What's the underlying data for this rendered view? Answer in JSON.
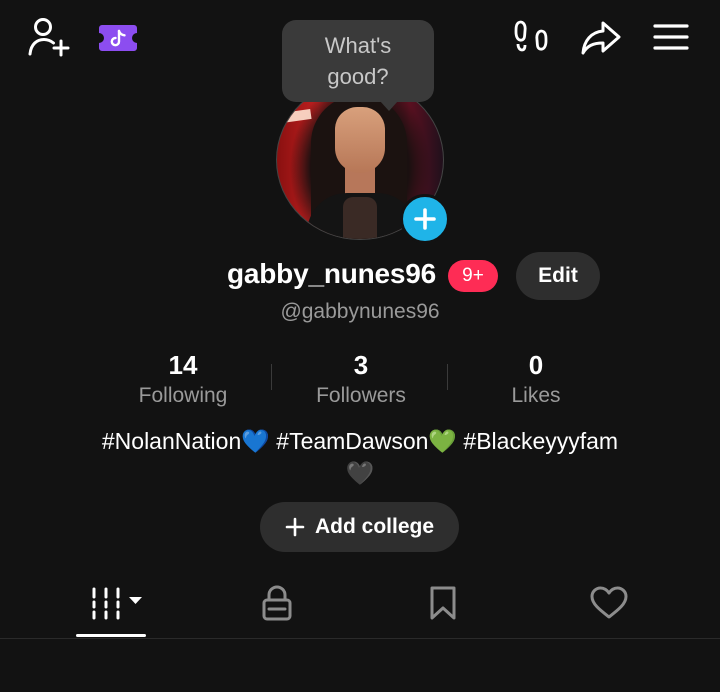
{
  "header": {
    "icons": [
      "add-friend-icon",
      "tiktok-ticket-icon",
      "footprints-icon",
      "share-icon",
      "menu-icon"
    ],
    "tiktok_badge_color": "#8c4df0"
  },
  "avatar": {
    "bubble_text": "What's good?",
    "add_icon": "plus-icon",
    "add_color": "#1fb4e8"
  },
  "profile": {
    "display_name": "gabby_nunes96",
    "notification_badge": "9+",
    "badge_color": "#fe2c55",
    "edit_label": "Edit",
    "handle": "@gabbynunes96"
  },
  "stats": [
    {
      "value": "14",
      "label": "Following"
    },
    {
      "value": "3",
      "label": "Followers"
    },
    {
      "value": "0",
      "label": "Likes"
    }
  ],
  "bio": {
    "line1": "#NolanNation💙 #TeamDawson💚 #Blackeyyyfam",
    "line2": "🖤"
  },
  "college_button": {
    "icon": "plus-icon",
    "label": "Add college"
  },
  "tabs": [
    {
      "name": "videos",
      "icon": "grid-dropdown-icon",
      "active": true
    },
    {
      "name": "private",
      "icon": "lock-icon",
      "active": false
    },
    {
      "name": "favorites",
      "icon": "bookmark-icon",
      "active": false
    },
    {
      "name": "liked",
      "icon": "heart-icon",
      "active": false
    }
  ]
}
